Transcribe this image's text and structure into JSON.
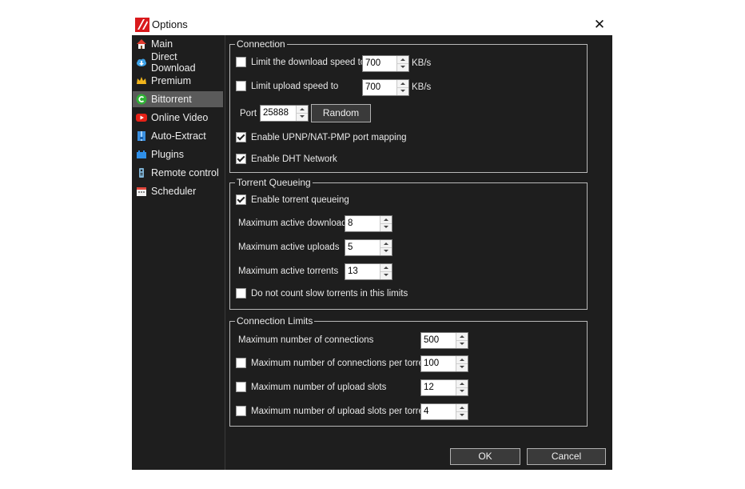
{
  "window": {
    "title": "Options",
    "close_glyph": "✕"
  },
  "sidebar": {
    "items": [
      {
        "label": "Main",
        "icon": "house-icon"
      },
      {
        "label": "Direct Download",
        "icon": "cloud-download-icon"
      },
      {
        "label": "Premium",
        "icon": "crown-icon"
      },
      {
        "label": "Bittorrent",
        "icon": "bittorrent-icon",
        "selected": true
      },
      {
        "label": "Online Video",
        "icon": "youtube-icon"
      },
      {
        "label": "Auto-Extract",
        "icon": "archive-icon"
      },
      {
        "label": "Plugins",
        "icon": "plugin-icon"
      },
      {
        "label": "Remote control",
        "icon": "remote-icon"
      },
      {
        "label": "Scheduler",
        "icon": "calendar-icon"
      }
    ]
  },
  "connection": {
    "title": "Connection",
    "limit_download": {
      "label": "Limit the download speed to",
      "checked": false,
      "value": "700",
      "unit": "KB/s"
    },
    "limit_upload": {
      "label": "Limit upload speed to",
      "checked": false,
      "value": "700",
      "unit": "KB/s"
    },
    "port": {
      "label": "Port",
      "value": "25888",
      "random_label": "Random"
    },
    "upnp": {
      "label": "Enable UPNP/NAT-PMP port mapping",
      "checked": true
    },
    "dht": {
      "label": "Enable DHT Network",
      "checked": true
    }
  },
  "queueing": {
    "title": "Torrent Queueing",
    "enable": {
      "label": "Enable torrent queueing",
      "checked": true
    },
    "max_downloads": {
      "label": "Maximum active downloads",
      "value": "8"
    },
    "max_uploads": {
      "label": "Maximum active uploads",
      "value": "5"
    },
    "max_torrents": {
      "label": "Maximum active torrents",
      "value": "13"
    },
    "slow": {
      "label": "Do not count slow torrents in this limits",
      "checked": false
    }
  },
  "limits": {
    "title": "Connection Limits",
    "max_connections": {
      "label": "Maximum number of connections",
      "value": "500"
    },
    "per_torrent": {
      "label": "Maximum number of connections per torrent",
      "checked": false,
      "value": "100"
    },
    "upload_slots": {
      "label": "Maximum number of upload slots",
      "checked": false,
      "value": "12"
    },
    "slots_per_torrent": {
      "label": "Maximum number of upload slots per torrent",
      "checked": false,
      "value": "4"
    }
  },
  "buttons": {
    "ok": "OK",
    "cancel": "Cancel"
  }
}
